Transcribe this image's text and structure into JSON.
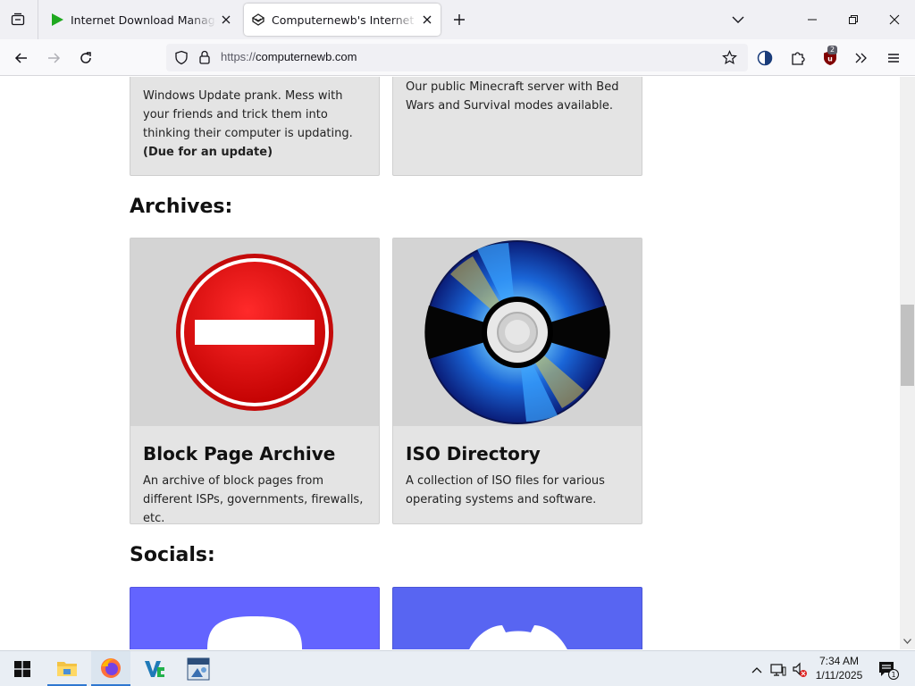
{
  "browser": {
    "tabs": [
      {
        "title": "Internet Download Manager is a",
        "active": false
      },
      {
        "title": "Computernewb's Internet Pub",
        "active": true
      }
    ],
    "url_scheme": "https://",
    "url_host": "computernewb.com",
    "extension_badge": "2"
  },
  "page": {
    "top_cards": [
      {
        "desc": "Windows Update prank. Mess with your friends and trick them into thinking their computer is updating.",
        "note": "(Due for an update)"
      },
      {
        "desc": "Our public Minecraft server with Bed Wars and Survival modes available."
      }
    ],
    "archives_heading": "Archives:",
    "archives": [
      {
        "title": "Block Page Archive",
        "desc": "An archive of block pages from different ISPs, governments, firewalls, etc.",
        "icon": "no-entry-icon"
      },
      {
        "title": "ISO Directory",
        "desc": "A collection of ISO files for various operating systems and software.",
        "icon": "cd-disc-icon"
      }
    ],
    "socials_heading": "Socials:",
    "socials": [
      {
        "icon": "mastodon-icon",
        "color": "#6364ff"
      },
      {
        "icon": "discord-icon",
        "color": "#5865f2"
      }
    ]
  },
  "taskbar": {
    "apps": [
      "file-explorer-icon",
      "firefox-icon",
      "vs-code-icon",
      "iso-tool-icon"
    ],
    "time": "7:34 AM",
    "date": "1/11/2025",
    "notifications": "1"
  }
}
